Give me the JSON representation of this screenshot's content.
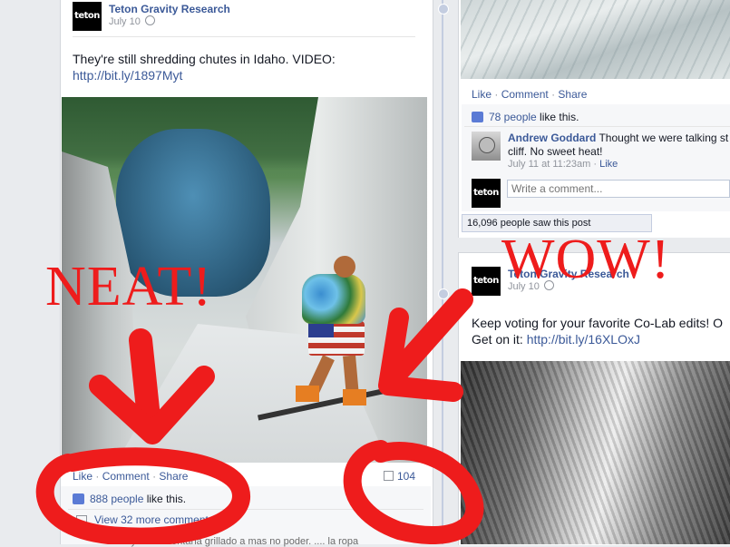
{
  "left_post": {
    "page_name": "Teton Gravity Research",
    "date": "July 10",
    "text_line1": "They're still shredding chutes in Idaho. VIDEO:",
    "link": "http://bit.ly/1897Myt",
    "actions": {
      "like": "Like",
      "comment": "Comment",
      "share": "Share"
    },
    "comment_count": "104",
    "likes_count": "888 people",
    "likes_suffix": " like this.",
    "view_more": "View 32 more comments",
    "partial_comment": "Marky de la montaña grillado a mas no poder. .... la ropa"
  },
  "right_post_top": {
    "actions": {
      "like": "Like",
      "comment": "Comment",
      "share": "Share"
    },
    "likes_count": "78 people",
    "likes_suffix": " like this.",
    "comment": {
      "author": "Andrew Goddard",
      "text_line1": "Thought we were talking st",
      "text_line2": "cliff. No sweet heat!",
      "timestamp": "July 11 at 11:23am",
      "like": "Like"
    },
    "comment_placeholder": "Write a comment...",
    "seen": "16,096 people saw this post"
  },
  "right_post_bottom": {
    "page_name": "Teton Gravity Research",
    "date": "July 10",
    "text_line1": "Keep voting for your favorite Co-Lab edits! O",
    "text_line2_prefix": "Get on it: ",
    "link": "http://bit.ly/16XLOxJ"
  },
  "avatar_text": "teton",
  "annotations": {
    "left": "NEAT!",
    "right": "WOW!",
    "color": "#ee1c1c"
  }
}
